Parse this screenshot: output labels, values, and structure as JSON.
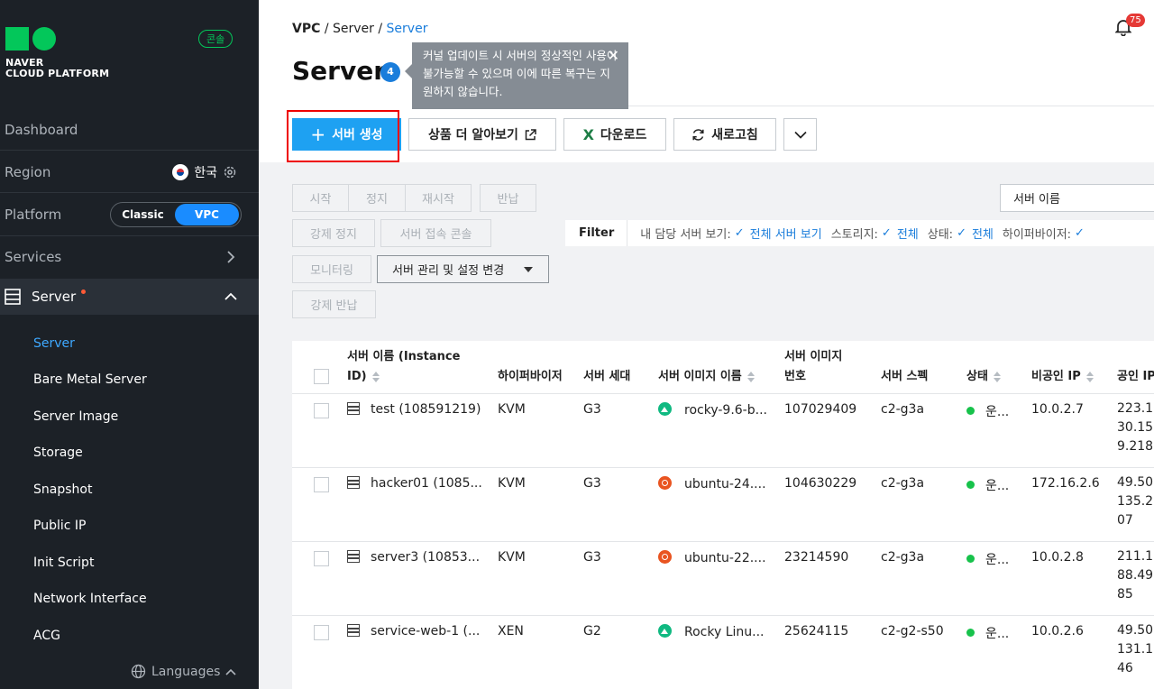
{
  "sidebar": {
    "brand_line1": "NAVER",
    "brand_line2": "CLOUD PLATFORM",
    "console_label": "콘솔",
    "dashboard": "Dashboard",
    "region_label": "Region",
    "region_value": "한국",
    "platform_label": "Platform",
    "platform_options": [
      "Classic",
      "VPC"
    ],
    "platform_selected": "VPC",
    "services_label": "Services",
    "server_label": "Server",
    "items": [
      "Server",
      "Bare Metal Server",
      "Server Image",
      "Storage",
      "Snapshot",
      "Public IP",
      "Init Script",
      "Network Interface",
      "ACG"
    ],
    "active_item": "Server",
    "languages": "Languages"
  },
  "header": {
    "breadcrumb": [
      "VPC",
      "Server",
      "Server"
    ],
    "notification_count": "75",
    "title": "Server",
    "title_count": "4",
    "tooltip": "커널 업데이트 시 서버의 정상적인 사용이 불가능할 수 있으며 이에 따른 복구는 지원하지 않습니다."
  },
  "toolbar": {
    "create": "서버 생성",
    "learn_more": "상품 더 알아보기",
    "download": "다운로드",
    "refresh": "새로고침"
  },
  "actions": {
    "start": "시작",
    "stop": "정지",
    "restart": "재시작",
    "return": "반납",
    "force_stop": "강제 정지",
    "console": "서버 접속 콘솔",
    "monitoring": "모니터링",
    "manage": "서버 관리 및 설정 변경",
    "force_return": "강제 반납"
  },
  "search_select": "서버 이름",
  "filter": {
    "label": "Filter",
    "my_servers": "내 담당 서버 보기:",
    "my_servers_value": "전체 서버 보기",
    "storage": "스토리지:",
    "storage_value": "전체",
    "status": "상태:",
    "status_value": "전체",
    "hypervisor": "하이퍼바이저:"
  },
  "table": {
    "columns": {
      "name": "서버 이름 (Instance ID)",
      "hypervisor": "하이퍼바이저",
      "generation": "서버 세대",
      "image_name": "서버 이미지 이름",
      "image_no": "서버 이미지 번호",
      "spec": "서버 스펙",
      "status": "상태",
      "private_ip": "비공인 IP",
      "public_ip": "공인 IP"
    },
    "rows": [
      {
        "name": "test (108591219)",
        "hypervisor": "KVM",
        "generation": "G3",
        "os": "rocky",
        "image": "rocky-9.6-b...",
        "image_no": "107029409",
        "spec": "c2-g3a",
        "status": "운...",
        "private_ip": "10.0.2.7",
        "public_ip": "223.130.159.218"
      },
      {
        "name": "hacker01 (1085...",
        "hypervisor": "KVM",
        "generation": "G3",
        "os": "ubuntu",
        "image": "ubuntu-24....",
        "image_no": "104630229",
        "spec": "c2-g3a",
        "status": "운...",
        "private_ip": "172.16.2.6",
        "public_ip": "49.50.135.207"
      },
      {
        "name": "server3 (10853...",
        "hypervisor": "KVM",
        "generation": "G3",
        "os": "ubuntu",
        "image": "ubuntu-22....",
        "image_no": "23214590",
        "spec": "c2-g3a",
        "status": "운...",
        "private_ip": "10.0.2.8",
        "public_ip": "211.188.49.85"
      },
      {
        "name": "service-web-1 (...",
        "hypervisor": "XEN",
        "generation": "G2",
        "os": "rocky",
        "image": "Rocky Linu...",
        "image_no": "25624115",
        "spec": "c2-g2-s50",
        "status": "운...",
        "private_ip": "10.0.2.6",
        "public_ip": "49.50.131.146"
      }
    ]
  }
}
